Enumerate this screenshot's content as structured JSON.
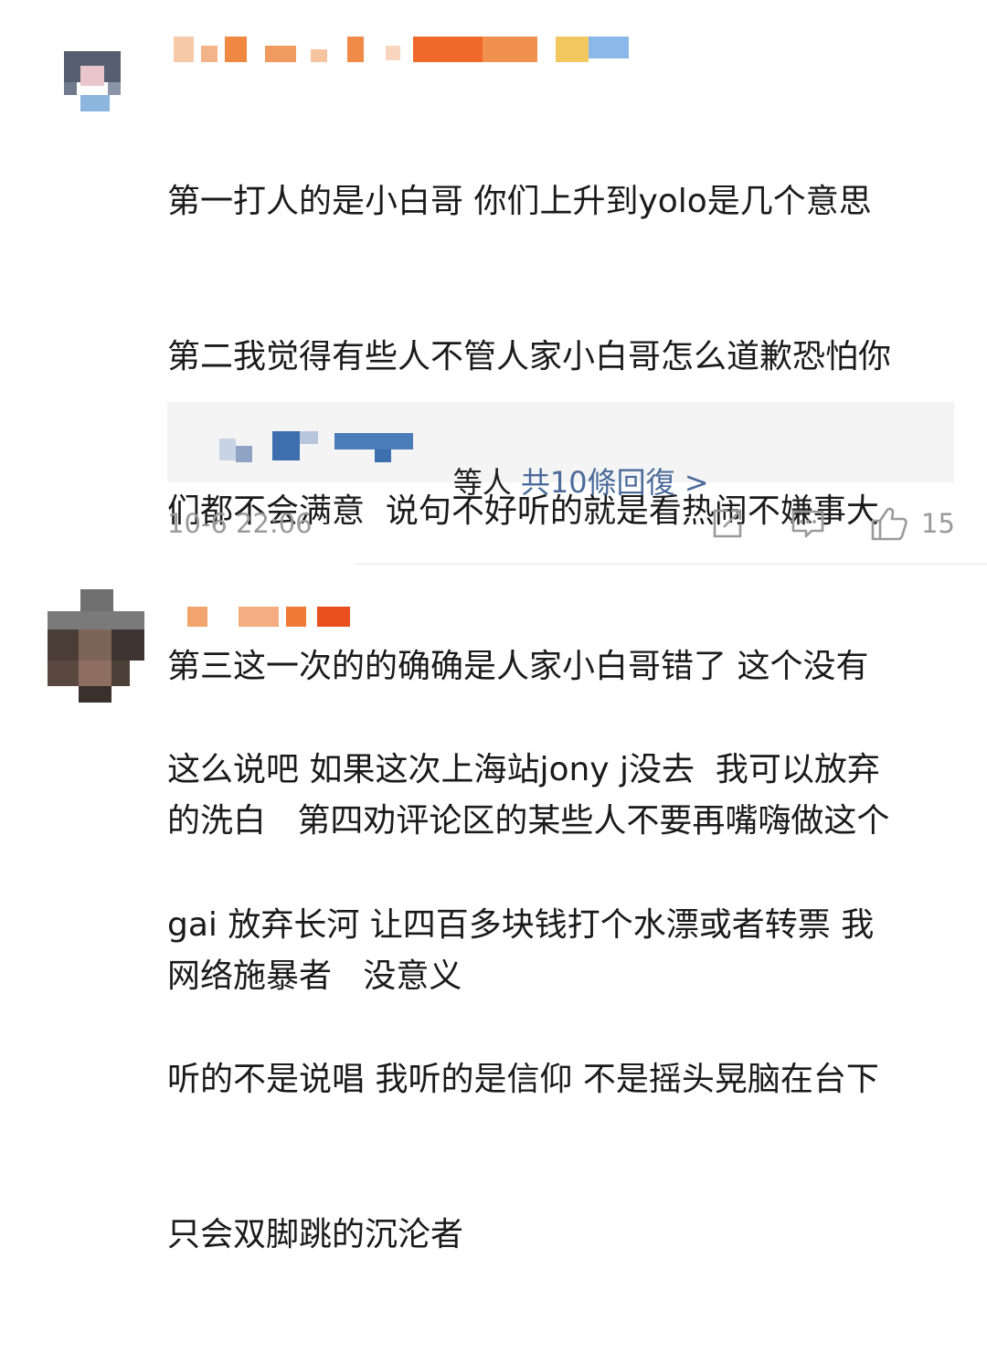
{
  "comments": [
    {
      "lines": [
        "第一打人的是小白哥 你们上升到yolo是几个意思",
        "第二我觉得有些人不管人家小白哥怎么道歉恐怕你",
        "们都不会满意  说句不好听的就是看热闹不嫌事大",
        "第三这一次的的确确是人家小白哥错了 这个没有",
        "的洗白   第四劝评论区的某些人不要再嘴嗨做这个",
        "网络施暴者   没意义"
      ],
      "reply_summary": {
        "suffix": "等人 ",
        "link": "共10條回復 >"
      },
      "timestamp": "10-6 22:06",
      "like_count": "15",
      "icons": [
        "share-icon",
        "comment-icon",
        "like-icon"
      ]
    },
    {
      "lines": [
        "这么说吧 如果这次上海站jony j没去  我可以放弃",
        "gai 放弃长河 让四百多块钱打个水漂或者转票 我",
        "听的不是说唱 我听的是信仰 不是摇头晃脑在台下",
        "只会双脚跳的沉沦者"
      ]
    }
  ],
  "colors": {
    "text": "#1a1a1a",
    "muted": "#9a9a9a",
    "link": "#4a6b9b",
    "reply_bg": "#f4f4f4"
  }
}
